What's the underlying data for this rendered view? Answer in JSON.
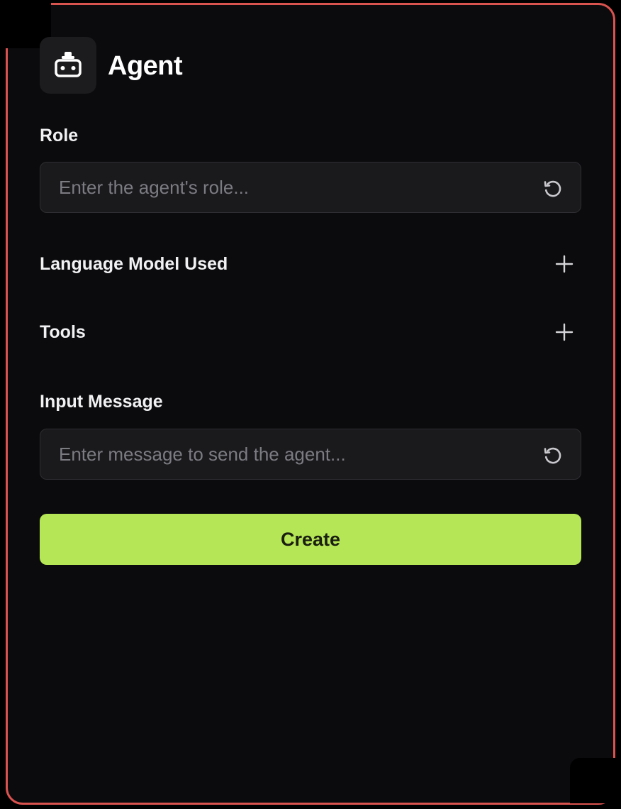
{
  "header": {
    "title": "Agent",
    "icon": "robot-icon"
  },
  "role": {
    "label": "Role",
    "placeholder": "Enter the agent's role...",
    "value": "",
    "reset_icon": "reset-icon"
  },
  "language_model": {
    "label": "Language Model Used",
    "add_icon": "plus-icon"
  },
  "tools": {
    "label": "Tools",
    "add_icon": "plus-icon"
  },
  "input_message": {
    "label": "Input Message",
    "placeholder": "Enter message to send the agent...",
    "value": "",
    "reset_icon": "reset-icon"
  },
  "actions": {
    "create_label": "Create"
  },
  "colors": {
    "background": "#0b0b0d",
    "border_accent": "#d9534f",
    "field_bg": "#1a1a1d",
    "button_accent": "#b5e655"
  }
}
